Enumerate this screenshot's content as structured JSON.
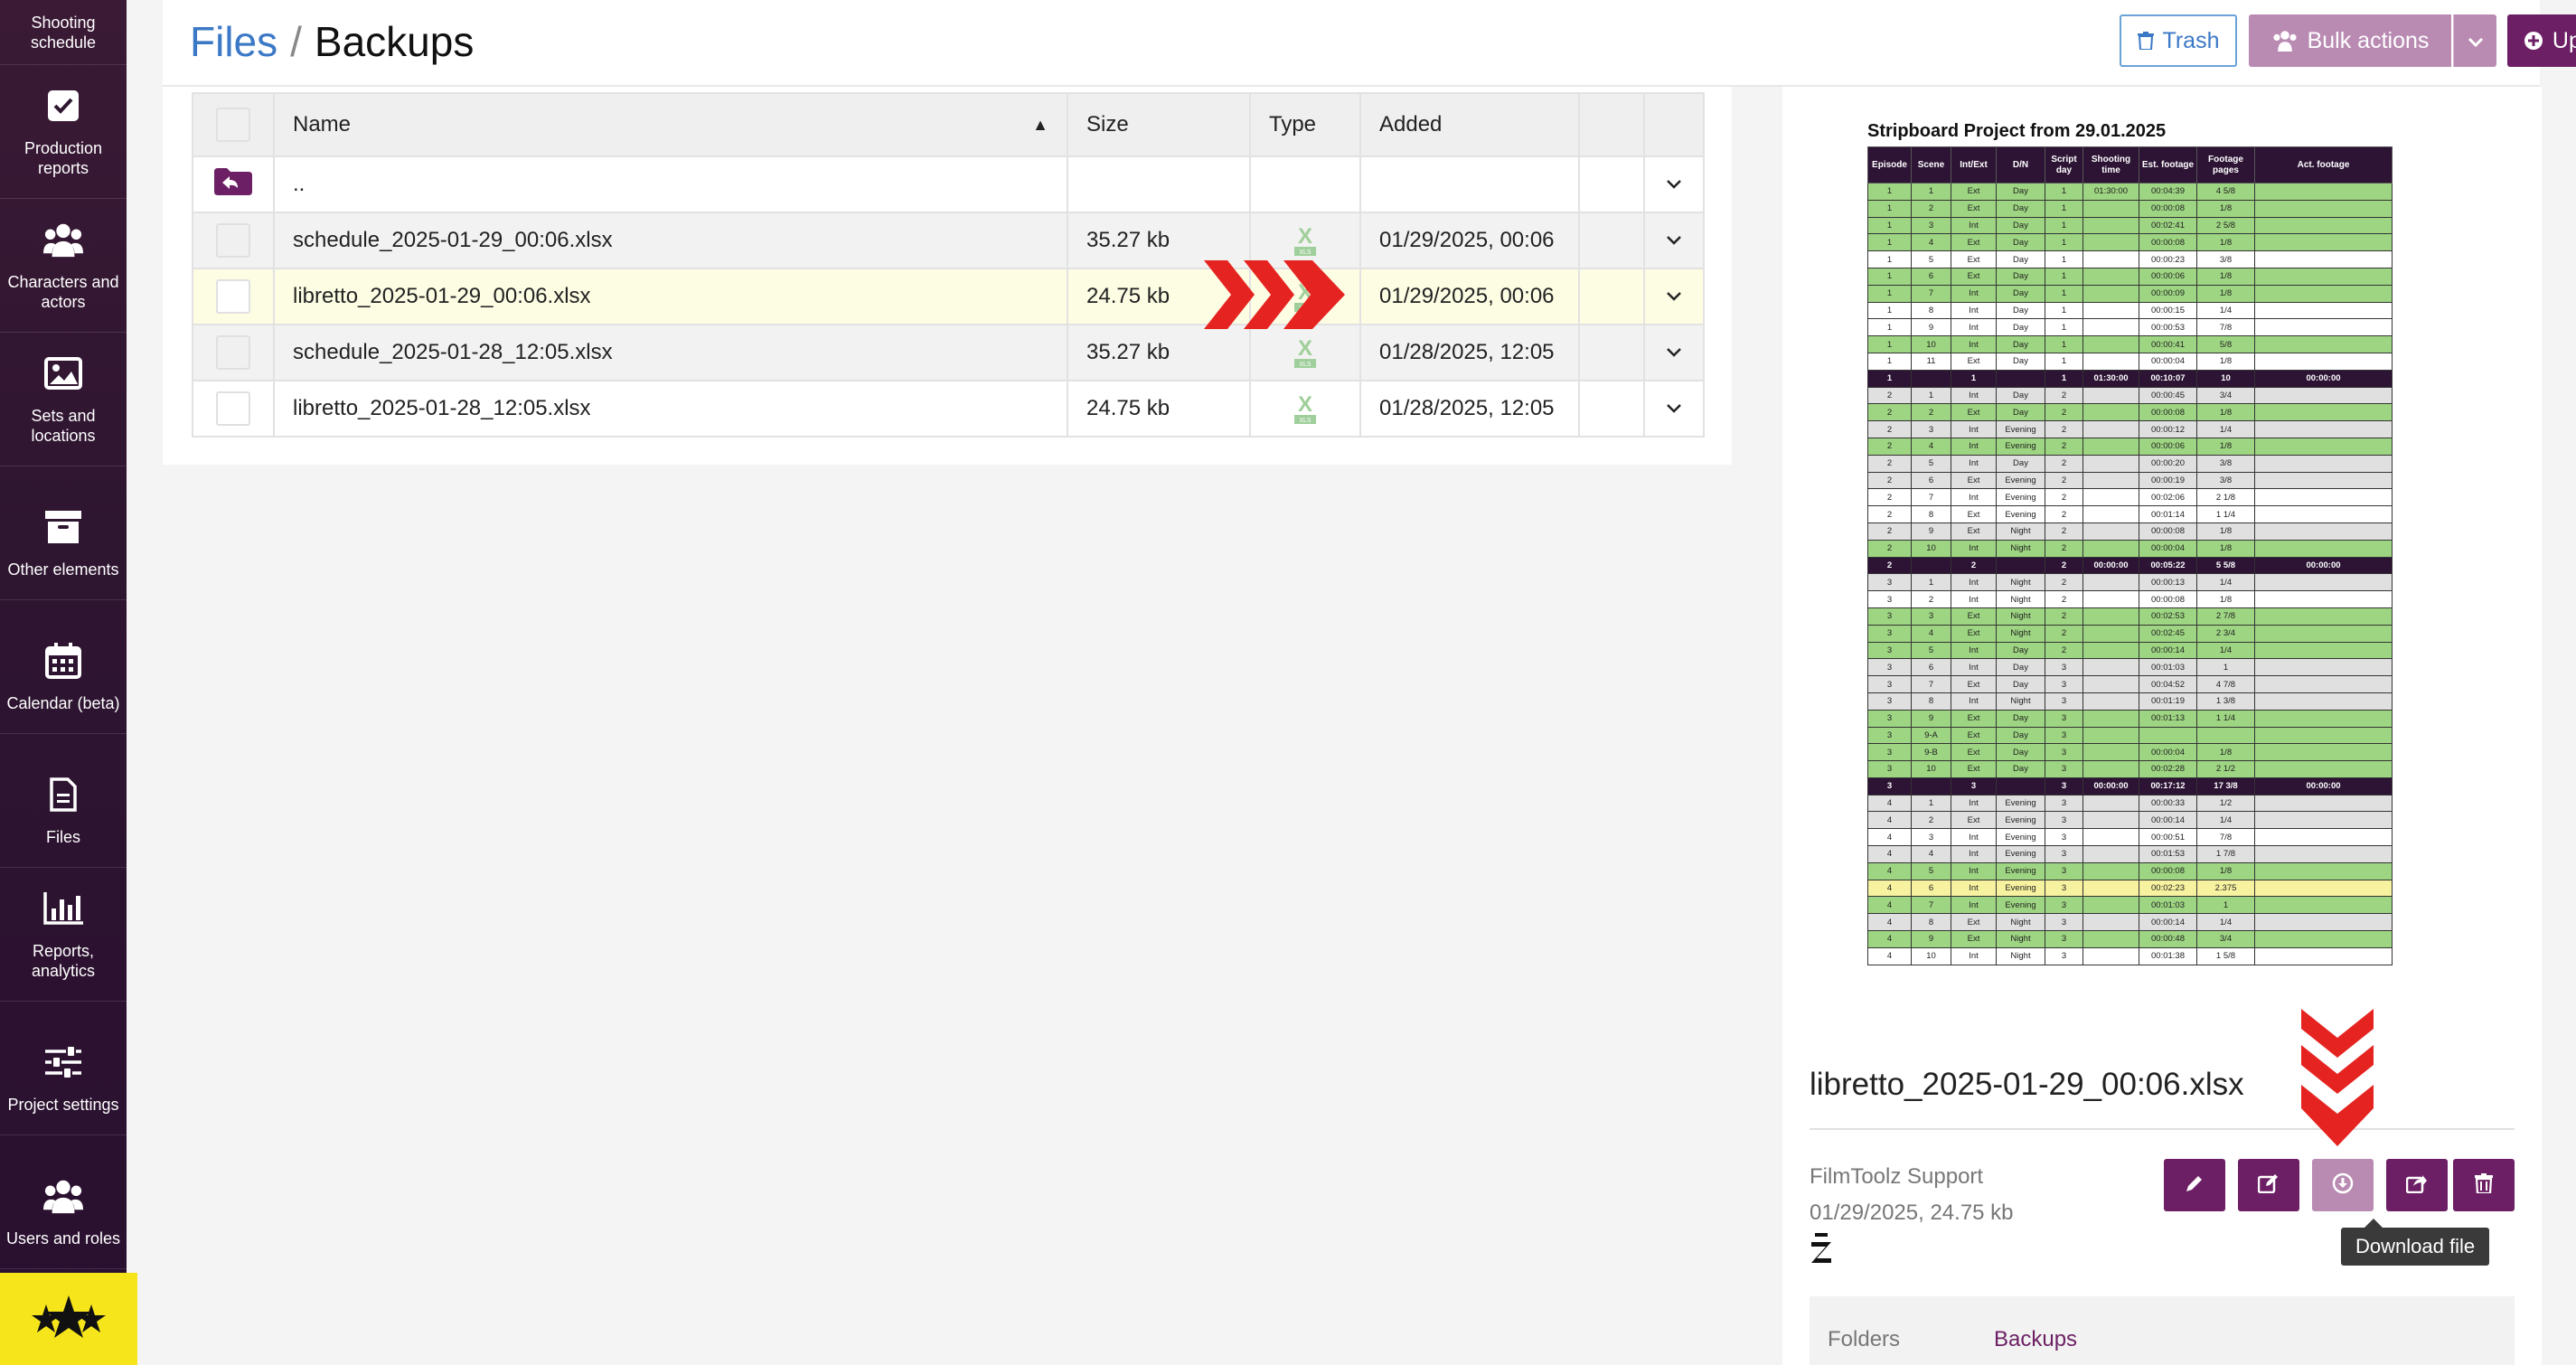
{
  "sidebar": {
    "items": [
      {
        "label": "Shooting schedule",
        "icon": "calendar-list-icon"
      },
      {
        "label": "Production reports",
        "icon": "checkbox-icon"
      },
      {
        "label": "Characters and actors",
        "icon": "people-group-icon"
      },
      {
        "label": "Sets and locations",
        "icon": "image-icon"
      },
      {
        "label": "Other elements",
        "icon": "archive-box-icon"
      },
      {
        "label": "Calendar (beta)",
        "icon": "calendar-icon"
      },
      {
        "label": "Files",
        "icon": "file-icon"
      },
      {
        "label": "Reports, analytics",
        "icon": "bar-chart-icon"
      },
      {
        "label": "Project settings",
        "icon": "sliders-icon"
      },
      {
        "label": "Users and roles",
        "icon": "users-icon"
      }
    ]
  },
  "header": {
    "breadcrumb_root": "Files",
    "breadcrumb_sep": "/",
    "breadcrumb_current": "Backups",
    "trash_label": "Trash",
    "bulk_label": "Bulk actions",
    "upload_label": "Upload file"
  },
  "table": {
    "columns": {
      "name": "Name",
      "size": "Size",
      "type": "Type",
      "added": "Added"
    },
    "parent_row": "..",
    "rows": [
      {
        "name": "schedule_2025-01-29_00:06.xlsx",
        "size": "35.27 kb",
        "added": "01/29/2025, 00:06"
      },
      {
        "name": "libretto_2025-01-29_00:06.xlsx",
        "size": "24.75 kb",
        "added": "01/29/2025, 00:06"
      },
      {
        "name": "schedule_2025-01-28_12:05.xlsx",
        "size": "35.27 kb",
        "added": "01/28/2025, 12:05"
      },
      {
        "name": "libretto_2025-01-28_12:05.xlsx",
        "size": "24.75 kb",
        "added": "01/28/2025, 12:05"
      }
    ]
  },
  "preview": {
    "sheet_title": "Stripboard Project from 29.01.2025",
    "sheet_headers": [
      "Episode",
      "Scene",
      "Int/Ext",
      "D/N",
      "Script day",
      "Shooting time",
      "Est. footage",
      "Footage pages",
      "Act. footage"
    ],
    "sheet_rows": [
      {
        "c": "g",
        "v": [
          "1",
          "1",
          "Ext",
          "Day",
          "1",
          "01:30:00",
          "00:04:39",
          "4 5/8",
          ""
        ]
      },
      {
        "c": "g",
        "v": [
          "1",
          "2",
          "Ext",
          "Day",
          "1",
          "",
          "00:00:08",
          "1/8",
          ""
        ]
      },
      {
        "c": "g",
        "v": [
          "1",
          "3",
          "Int",
          "Day",
          "1",
          "",
          "00:02:41",
          "2 5/8",
          ""
        ]
      },
      {
        "c": "g",
        "v": [
          "1",
          "4",
          "Ext",
          "Day",
          "1",
          "",
          "00:00:08",
          "1/8",
          ""
        ]
      },
      {
        "c": "w",
        "v": [
          "1",
          "5",
          "Ext",
          "Day",
          "1",
          "",
          "00:00:23",
          "3/8",
          ""
        ]
      },
      {
        "c": "g",
        "v": [
          "1",
          "6",
          "Ext",
          "Day",
          "1",
          "",
          "00:00:06",
          "1/8",
          ""
        ]
      },
      {
        "c": "g",
        "v": [
          "1",
          "7",
          "Int",
          "Day",
          "1",
          "",
          "00:00:09",
          "1/8",
          ""
        ]
      },
      {
        "c": "w",
        "v": [
          "1",
          "8",
          "Int",
          "Day",
          "1",
          "",
          "00:00:15",
          "1/4",
          ""
        ]
      },
      {
        "c": "w",
        "v": [
          "1",
          "9",
          "Int",
          "Day",
          "1",
          "",
          "00:00:53",
          "7/8",
          ""
        ]
      },
      {
        "c": "g",
        "v": [
          "1",
          "10",
          "Int",
          "Day",
          "1",
          "",
          "00:00:41",
          "5/8",
          ""
        ]
      },
      {
        "c": "w",
        "v": [
          "1",
          "11",
          "Ext",
          "Day",
          "1",
          "",
          "00:00:04",
          "1/8",
          ""
        ]
      },
      {
        "c": "t",
        "v": [
          "1",
          "",
          "1",
          "",
          "1",
          "01:30:00",
          "00:10:07",
          "10",
          "00:00:00"
        ]
      },
      {
        "c": "s",
        "v": [
          "2",
          "1",
          "Int",
          "Day",
          "2",
          "",
          "00:00:45",
          "3/4",
          ""
        ]
      },
      {
        "c": "g",
        "v": [
          "2",
          "2",
          "Ext",
          "Day",
          "2",
          "",
          "00:00:08",
          "1/8",
          ""
        ]
      },
      {
        "c": "s",
        "v": [
          "2",
          "3",
          "Int",
          "Evening",
          "2",
          "",
          "00:00:12",
          "1/4",
          ""
        ]
      },
      {
        "c": "g",
        "v": [
          "2",
          "4",
          "Int",
          "Evening",
          "2",
          "",
          "00:00:06",
          "1/8",
          ""
        ]
      },
      {
        "c": "s",
        "v": [
          "2",
          "5",
          "Int",
          "Day",
          "2",
          "",
          "00:00:20",
          "3/8",
          ""
        ]
      },
      {
        "c": "s",
        "v": [
          "2",
          "6",
          "Ext",
          "Evening",
          "2",
          "",
          "00:00:19",
          "3/8",
          ""
        ]
      },
      {
        "c": "w",
        "v": [
          "2",
          "7",
          "Int",
          "Evening",
          "2",
          "",
          "00:02:06",
          "2 1/8",
          ""
        ]
      },
      {
        "c": "w",
        "v": [
          "2",
          "8",
          "Ext",
          "Evening",
          "2",
          "",
          "00:01:14",
          "1 1/4",
          ""
        ]
      },
      {
        "c": "s",
        "v": [
          "2",
          "9",
          "Ext",
          "Night",
          "2",
          "",
          "00:00:08",
          "1/8",
          ""
        ]
      },
      {
        "c": "g",
        "v": [
          "2",
          "10",
          "Int",
          "Night",
          "2",
          "",
          "00:00:04",
          "1/8",
          ""
        ]
      },
      {
        "c": "t",
        "v": [
          "2",
          "",
          "2",
          "",
          "2",
          "00:00:00",
          "00:05:22",
          "5 5/8",
          "00:00:00"
        ]
      },
      {
        "c": "s",
        "v": [
          "3",
          "1",
          "Int",
          "Night",
          "2",
          "",
          "00:00:13",
          "1/4",
          ""
        ]
      },
      {
        "c": "w",
        "v": [
          "3",
          "2",
          "Int",
          "Night",
          "2",
          "",
          "00:00:08",
          "1/8",
          ""
        ]
      },
      {
        "c": "g",
        "v": [
          "3",
          "3",
          "Ext",
          "Night",
          "2",
          "",
          "00:02:53",
          "2 7/8",
          ""
        ]
      },
      {
        "c": "g",
        "v": [
          "3",
          "4",
          "Ext",
          "Night",
          "2",
          "",
          "00:02:45",
          "2 3/4",
          ""
        ]
      },
      {
        "c": "g",
        "v": [
          "3",
          "5",
          "Int",
          "Day",
          "2",
          "",
          "00:00:14",
          "1/4",
          ""
        ]
      },
      {
        "c": "s",
        "v": [
          "3",
          "6",
          "Int",
          "Day",
          "3",
          "",
          "00:01:03",
          "1",
          ""
        ]
      },
      {
        "c": "s",
        "v": [
          "3",
          "7",
          "Ext",
          "Day",
          "3",
          "",
          "00:04:52",
          "4 7/8",
          ""
        ]
      },
      {
        "c": "s",
        "v": [
          "3",
          "8",
          "Int",
          "Night",
          "3",
          "",
          "00:01:19",
          "1 3/8",
          ""
        ]
      },
      {
        "c": "g",
        "v": [
          "3",
          "9",
          "Ext",
          "Day",
          "3",
          "",
          "00:01:13",
          "1 1/4",
          ""
        ]
      },
      {
        "c": "g",
        "v": [
          "3",
          "9-A",
          "Ext",
          "Day",
          "3",
          "",
          "",
          "",
          ""
        ]
      },
      {
        "c": "g",
        "v": [
          "3",
          "9-B",
          "Ext",
          "Day",
          "3",
          "",
          "00:00:04",
          "1/8",
          ""
        ]
      },
      {
        "c": "g",
        "v": [
          "3",
          "10",
          "Ext",
          "Day",
          "3",
          "",
          "00:02:28",
          "2 1/2",
          ""
        ]
      },
      {
        "c": "t",
        "v": [
          "3",
          "",
          "3",
          "",
          "3",
          "00:00:00",
          "00:17:12",
          "17 3/8",
          "00:00:00"
        ]
      },
      {
        "c": "s",
        "v": [
          "4",
          "1",
          "Int",
          "Evening",
          "3",
          "",
          "00:00:33",
          "1/2",
          ""
        ]
      },
      {
        "c": "s",
        "v": [
          "4",
          "2",
          "Ext",
          "Evening",
          "3",
          "",
          "00:00:14",
          "1/4",
          ""
        ]
      },
      {
        "c": "w",
        "v": [
          "4",
          "3",
          "Int",
          "Evening",
          "3",
          "",
          "00:00:51",
          "7/8",
          ""
        ]
      },
      {
        "c": "s",
        "v": [
          "4",
          "4",
          "Int",
          "Evening",
          "3",
          "",
          "00:01:53",
          "1 7/8",
          ""
        ]
      },
      {
        "c": "g",
        "v": [
          "4",
          "5",
          "Int",
          "Evening",
          "3",
          "",
          "00:00:08",
          "1/8",
          ""
        ]
      },
      {
        "c": "y",
        "v": [
          "4",
          "6",
          "Int",
          "Evening",
          "3",
          "",
          "00:02:23",
          "2.375",
          ""
        ]
      },
      {
        "c": "g",
        "v": [
          "4",
          "7",
          "Int",
          "Evening",
          "3",
          "",
          "00:01:03",
          "1",
          ""
        ]
      },
      {
        "c": "s",
        "v": [
          "4",
          "8",
          "Ext",
          "Night",
          "3",
          "",
          "00:00:14",
          "1/4",
          ""
        ]
      },
      {
        "c": "g",
        "v": [
          "4",
          "9",
          "Ext",
          "Night",
          "3",
          "",
          "00:00:48",
          "3/4",
          ""
        ]
      },
      {
        "c": "w",
        "v": [
          "4",
          "10",
          "Int",
          "Night",
          "3",
          "",
          "00:01:38",
          "1 5/8",
          ""
        ]
      }
    ],
    "file_name": "libretto_2025-01-29_00:06.xlsx",
    "owner": "FilmToolz Support",
    "meta": "01/29/2025, 24.75 kb",
    "tooltip": "Download file",
    "folders_label": "Folders",
    "folders_value": "Backups"
  },
  "colors": {
    "sidebar_bg": "#2e1530",
    "accent_purple": "#6c1f64",
    "light_purple": "#b98bb3",
    "link_blue": "#3b78c6",
    "highlight_row": "#fdfde4",
    "arrow_red": "#e52421"
  }
}
